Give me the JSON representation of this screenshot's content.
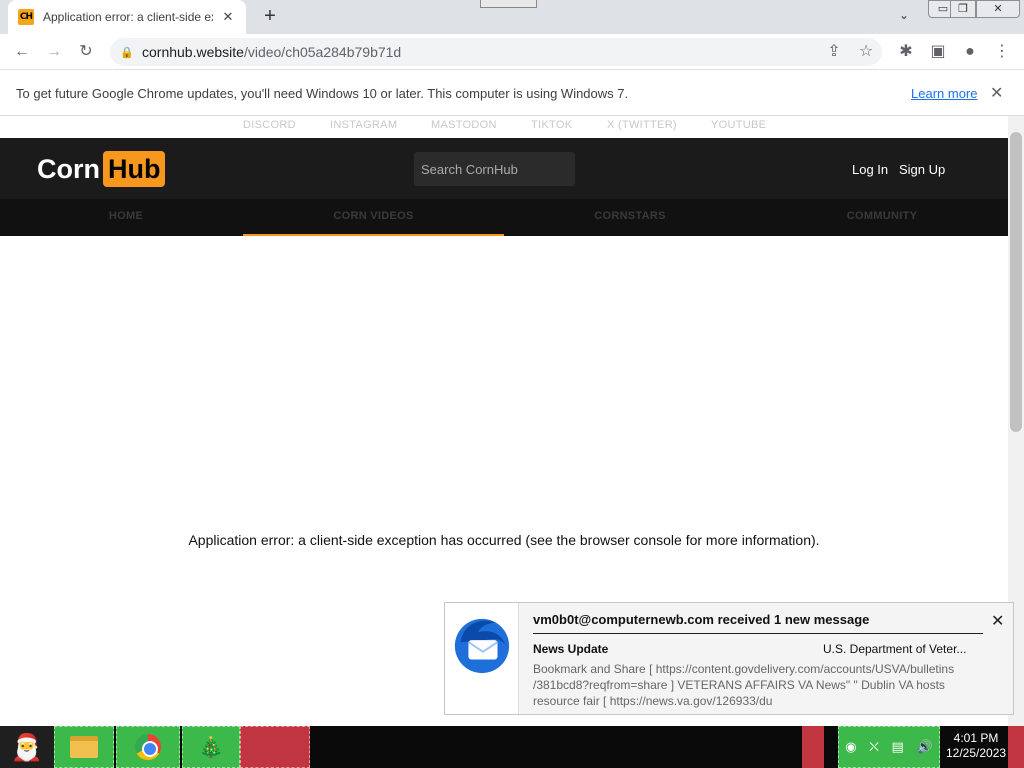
{
  "browser": {
    "tab": {
      "favicon_text": "CH",
      "title": "Application error: a client-side exception has occurred",
      "close": "✕"
    },
    "new_tab": "+",
    "tab_search": "⌄",
    "window_controls": {
      "minimize": "▭",
      "maximize": "❐",
      "close": "✕"
    },
    "toolbar": {
      "back": "←",
      "forward": "→",
      "reload": "↻",
      "lock": "🔒",
      "url_host": "cornhub.website",
      "url_path": "/video/ch05a284b79b71d",
      "share": "⇪",
      "bookmark": "☆",
      "extensions": "✱",
      "sidepanel": "▣",
      "profile": "●",
      "menu": "⋮"
    },
    "infobar": {
      "text": "To get future Google Chrome updates, you'll need Windows 10 or later. This computer is using Windows 7.",
      "link": "Learn more",
      "close": "✕"
    }
  },
  "page": {
    "social_links": [
      "DISCORD",
      "INSTAGRAM",
      "MASTODON",
      "TIKTOK",
      "X (TWITTER)",
      "YOUTUBE"
    ],
    "logo": {
      "part1": "Corn",
      "part2": "Hub"
    },
    "search_placeholder": "Search CornHub",
    "login": "Log In",
    "signup": "Sign Up",
    "nav": [
      "HOME",
      "CORN VIDEOS",
      "CORNSTARS",
      "COMMUNITY"
    ],
    "nav_active_index": 1,
    "error_message": "Application error: a client-side exception has occurred (see the browser console for more information)."
  },
  "notification": {
    "account": "vm0b0t@computernewb.com received 1 new message",
    "subject": "News Update",
    "sender": "U.S. Department of Veter...",
    "body": "Bookmark and Share [ https://content.govdelivery.com/accounts/USVA/bulletins /381bcd8?reqfrom=share ]     VETERANS AFFAIRS            VA News\" \"       Dublin VA hosts resource fair [ https://news.va.gov/126933/du",
    "close": "✕"
  },
  "taskbar": {
    "start_icon": "🎅",
    "tree_icon": "🎄",
    "clock_time": "4:01 PM",
    "clock_date": "12/25/2023",
    "tray_icons": [
      "◉",
      "⛌",
      "▤",
      "🔊"
    ]
  },
  "colors": {
    "brand_orange": "#f7971d",
    "header_bg": "#1b1b1b",
    "link_blue": "#1a73e8",
    "taskbar_green": "#3db84a",
    "taskbar_red": "#c0353f"
  }
}
